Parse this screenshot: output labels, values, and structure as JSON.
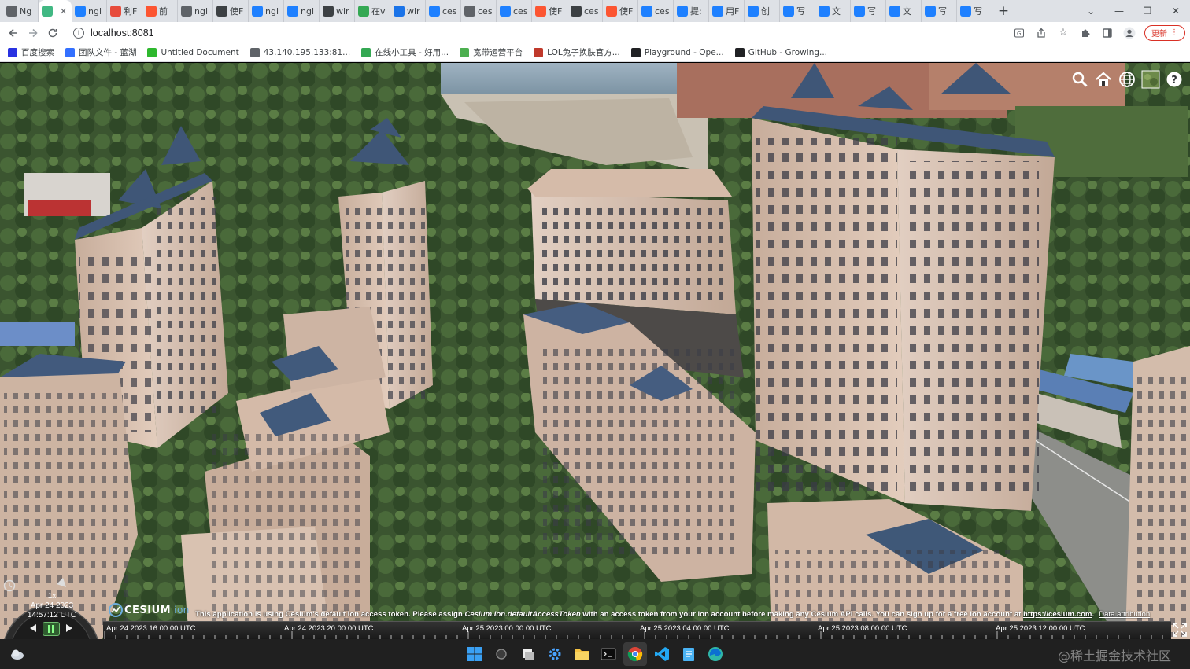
{
  "browser": {
    "tabs": [
      {
        "label": "Ng",
        "icon": "globe-icon",
        "color": "#5f6368"
      },
      {
        "label": "",
        "icon": "vue-icon",
        "color": "#41b883",
        "active": true
      },
      {
        "label": "ngi",
        "icon": "juejin-icon",
        "color": "#1e80ff"
      },
      {
        "label": "利F",
        "icon": "zhihu-icon",
        "color": "#e74c3c"
      },
      {
        "label": "前",
        "icon": "csdn-icon",
        "color": "#fc5531"
      },
      {
        "label": "ngi",
        "icon": "globe-icon",
        "color": "#5f6368"
      },
      {
        "label": "使F",
        "icon": "segmentfault-icon",
        "color": "#3c4043"
      },
      {
        "label": "ngi",
        "icon": "juejin-icon",
        "color": "#1e80ff"
      },
      {
        "label": "ngi",
        "icon": "juejin-icon",
        "color": "#1e80ff"
      },
      {
        "label": "wir",
        "icon": "segmentfault-icon",
        "color": "#3c4043"
      },
      {
        "label": "在v",
        "icon": "tool-icon",
        "color": "#34a853"
      },
      {
        "label": "wir",
        "icon": "bing-icon",
        "color": "#1a73e8"
      },
      {
        "label": "ces",
        "icon": "juejin-icon",
        "color": "#1e80ff"
      },
      {
        "label": "ces",
        "icon": "globe-icon",
        "color": "#5f6368"
      },
      {
        "label": "ces",
        "icon": "juejin-icon",
        "color": "#1e80ff"
      },
      {
        "label": "使F",
        "icon": "csdn-icon",
        "color": "#fc5531"
      },
      {
        "label": "ces",
        "icon": "segmentfault-icon",
        "color": "#3c4043"
      },
      {
        "label": "使F",
        "icon": "csdn-icon",
        "color": "#fc5531"
      },
      {
        "label": "ces",
        "icon": "juejin-icon",
        "color": "#1e80ff"
      },
      {
        "label": "提:",
        "icon": "juejin-icon",
        "color": "#1e80ff"
      },
      {
        "label": "用F",
        "icon": "juejin-blue-icon",
        "color": "#1e80ff"
      },
      {
        "label": "创",
        "icon": "juejin-blue-icon",
        "color": "#1e80ff"
      },
      {
        "label": "写",
        "icon": "juejin-blue-icon",
        "color": "#1e80ff"
      },
      {
        "label": "文",
        "icon": "juejin-blue-icon",
        "color": "#1e80ff"
      },
      {
        "label": "写",
        "icon": "juejin-blue-icon",
        "color": "#1e80ff"
      },
      {
        "label": "文",
        "icon": "juejin-blue-icon",
        "color": "#1e80ff"
      },
      {
        "label": "写",
        "icon": "juejin-blue-icon",
        "color": "#1e80ff"
      },
      {
        "label": "写",
        "icon": "juejin-blue-icon",
        "color": "#1e80ff"
      }
    ],
    "address": "localhost:8081",
    "update_label": "更新",
    "bookmarks": [
      {
        "label": "百度搜索",
        "color": "#2932e1"
      },
      {
        "label": "团队文件 - 蓝湖",
        "color": "#3370ff"
      },
      {
        "label": "Untitled Document",
        "color": "#2eb82e"
      },
      {
        "label": "43.140.195.133:81...",
        "color": "#5f6368"
      },
      {
        "label": "在线小工具 - 好用...",
        "color": "#34a853"
      },
      {
        "label": "宽带运营平台",
        "color": "#4caf50"
      },
      {
        "label": "LOL兔子换肤官方...",
        "color": "#c0392b"
      },
      {
        "label": "Playground - Ope...",
        "color": "#202124"
      },
      {
        "label": "GitHub - Growing...",
        "color": "#202124"
      }
    ]
  },
  "cesium": {
    "toolbar": [
      "search-icon",
      "home-icon",
      "globe-icon",
      "imagery-picker-icon",
      "help-icon"
    ],
    "animation": {
      "speed": "1x",
      "date": "Apr 24 2023",
      "time": "14:57:12 UTC"
    },
    "logo_text": "CESIUM",
    "logo_suffix": "ion",
    "credit": {
      "pre": "This application is using Cesium's default ion access token. Please assign ",
      "token": "Cesium.Ion.defaultAccessToken",
      "mid": " with an access token from your ion account before making any Cesium API calls. You can sign up for a free ion account at ",
      "link": "https://cesium.com",
      "post": ".",
      "attribution": "Data attribution"
    },
    "timeline": [
      "Apr 24 2023 16:00:00 UTC",
      "Apr 24 2023 20:00:00 UTC",
      "Apr 25 2023 00:00:00 UTC",
      "Apr 25 2023 04:00:00 UTC",
      "Apr 25 2023 08:00:00 UTC",
      "Apr 25 2023 12:00:00 UTC"
    ]
  },
  "taskbar": {
    "apps": [
      "windows-start-icon",
      "search-icon",
      "task-view-icon",
      "settings-icon",
      "file-explorer-icon",
      "terminal-icon",
      "chrome-icon",
      "vscode-icon",
      "notepad-icon",
      "edge-icon"
    ],
    "watermark": "@稀土掘金技术社区"
  },
  "colors": {
    "sky": "#8fa7b8",
    "foliage": "#3e5a30",
    "building": "#d9bfae",
    "roof": "#3d5575",
    "timeline_bg": "#1f1f1f",
    "cesium_accent": "#6cadde"
  }
}
